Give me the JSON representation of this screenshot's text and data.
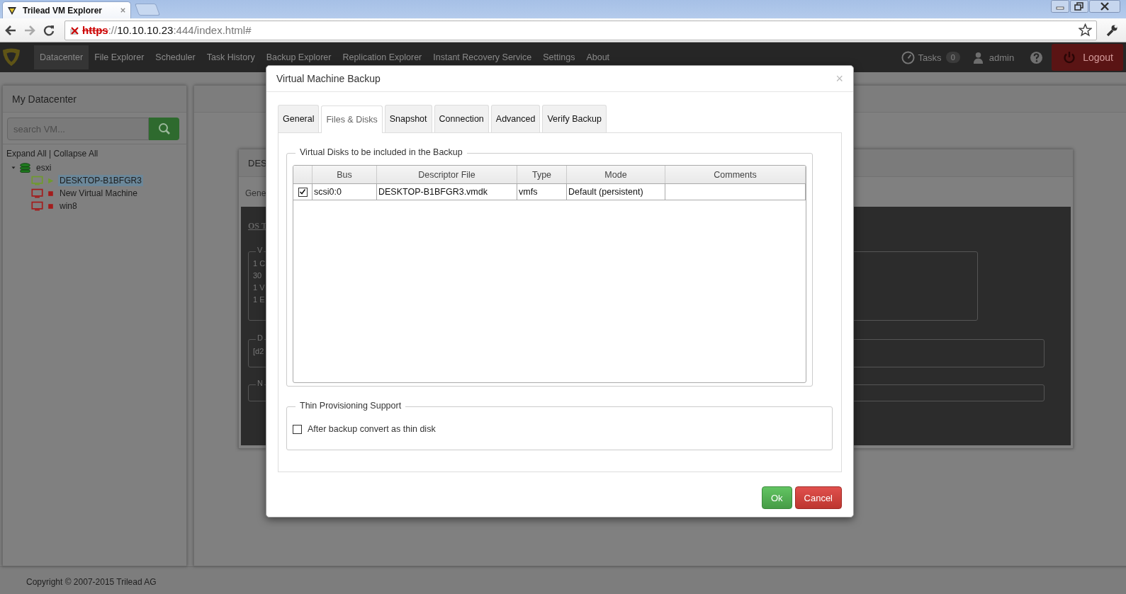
{
  "browser": {
    "tab_title": "Trilead VM Explorer",
    "url_scheme": "https",
    "url_sep": "://",
    "url_host": "10.10.10.23",
    "url_rest": ":444/index.html#"
  },
  "navbar": {
    "items": [
      {
        "label": "Datacenter",
        "selected": true
      },
      {
        "label": "File Explorer",
        "selected": false
      },
      {
        "label": "Scheduler",
        "selected": false
      },
      {
        "label": "Task History",
        "selected": false
      },
      {
        "label": "Backup Explorer",
        "selected": false
      },
      {
        "label": "Replication Explorer",
        "selected": false
      },
      {
        "label": "Instant Recovery Service",
        "selected": false
      },
      {
        "label": "Settings",
        "selected": false
      },
      {
        "label": "About",
        "selected": false
      }
    ],
    "tasks_label": "Tasks",
    "tasks_count": "0",
    "user": "admin",
    "logout": "Logout"
  },
  "sidebar": {
    "title": "My Datacenter",
    "search_placeholder": "search VM...",
    "expand_all": "Expand All",
    "separator": "|",
    "collapse_all": "Collapse All",
    "tree": [
      {
        "label": "esxi",
        "kind": "host",
        "expanded": true,
        "selected": false,
        "children": [
          {
            "label": "DESKTOP-B1BFGR3",
            "kind": "vm",
            "running": true,
            "selected": true
          },
          {
            "label": "New Virtual Machine",
            "kind": "vm",
            "running": false,
            "selected": false
          },
          {
            "label": "win8",
            "kind": "vm",
            "running": false,
            "selected": false
          }
        ]
      }
    ]
  },
  "background_panel": {
    "title": "DES",
    "tab": "Gene",
    "heading": "OS T",
    "groups": [
      {
        "legend": "V",
        "lines": [
          "1 C",
          "30",
          "1 V",
          "1 E"
        ]
      },
      {
        "legend": "D",
        "lines": [
          "[d2"
        ]
      },
      {
        "legend": "N"
      }
    ]
  },
  "footer": "Copyright © 2007-2015 Trilead AG",
  "dialog": {
    "title": "Virtual Machine Backup",
    "close": "×",
    "tabs": [
      {
        "label": "General",
        "selected": false
      },
      {
        "label": "Files & Disks",
        "selected": true
      },
      {
        "label": "Snapshot",
        "selected": false
      },
      {
        "label": "Connection",
        "selected": false
      },
      {
        "label": "Advanced",
        "selected": false
      },
      {
        "label": "Verify Backup",
        "selected": false
      }
    ],
    "disks": {
      "legend": "Virtual Disks to be included in the Backup",
      "columns": [
        "Bus",
        "Descriptor File",
        "Type",
        "Mode",
        "Comments"
      ],
      "rows": [
        {
          "checked": true,
          "cells": [
            "scsi0:0",
            "DESKTOP-B1BFGR3.vmdk",
            "vmfs",
            "Default (persistent)"
          ]
        }
      ]
    },
    "thin": {
      "legend": "Thin Provisioning Support",
      "label": "After backup convert as thin disk",
      "checked": false
    },
    "buttons": [
      {
        "label": "Ok",
        "kind": "primary"
      },
      {
        "label": "Cancel",
        "kind": "danger"
      }
    ]
  }
}
